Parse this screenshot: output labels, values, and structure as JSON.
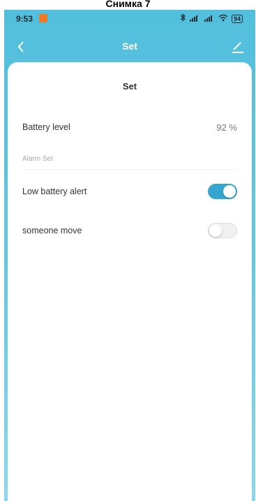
{
  "caption": "Снимка 7",
  "status_bar": {
    "time": "9:53",
    "battery": "94"
  },
  "nav": {
    "title": "Set",
    "back_icon": "chevron-left-icon",
    "edit_icon": "edit-pencil-icon"
  },
  "card": {
    "title": "Set",
    "battery_label": "Battery level",
    "battery_value": "92 %",
    "section_header": "Alarm Set",
    "low_battery_label": "Low battery alert",
    "low_battery_on": true,
    "someone_move_label": "someone move",
    "someone_move_on": false
  },
  "colors": {
    "header": "#52bfdc",
    "toggle_on": "#35a6cf",
    "toggle_off": "#f1f1f1"
  }
}
